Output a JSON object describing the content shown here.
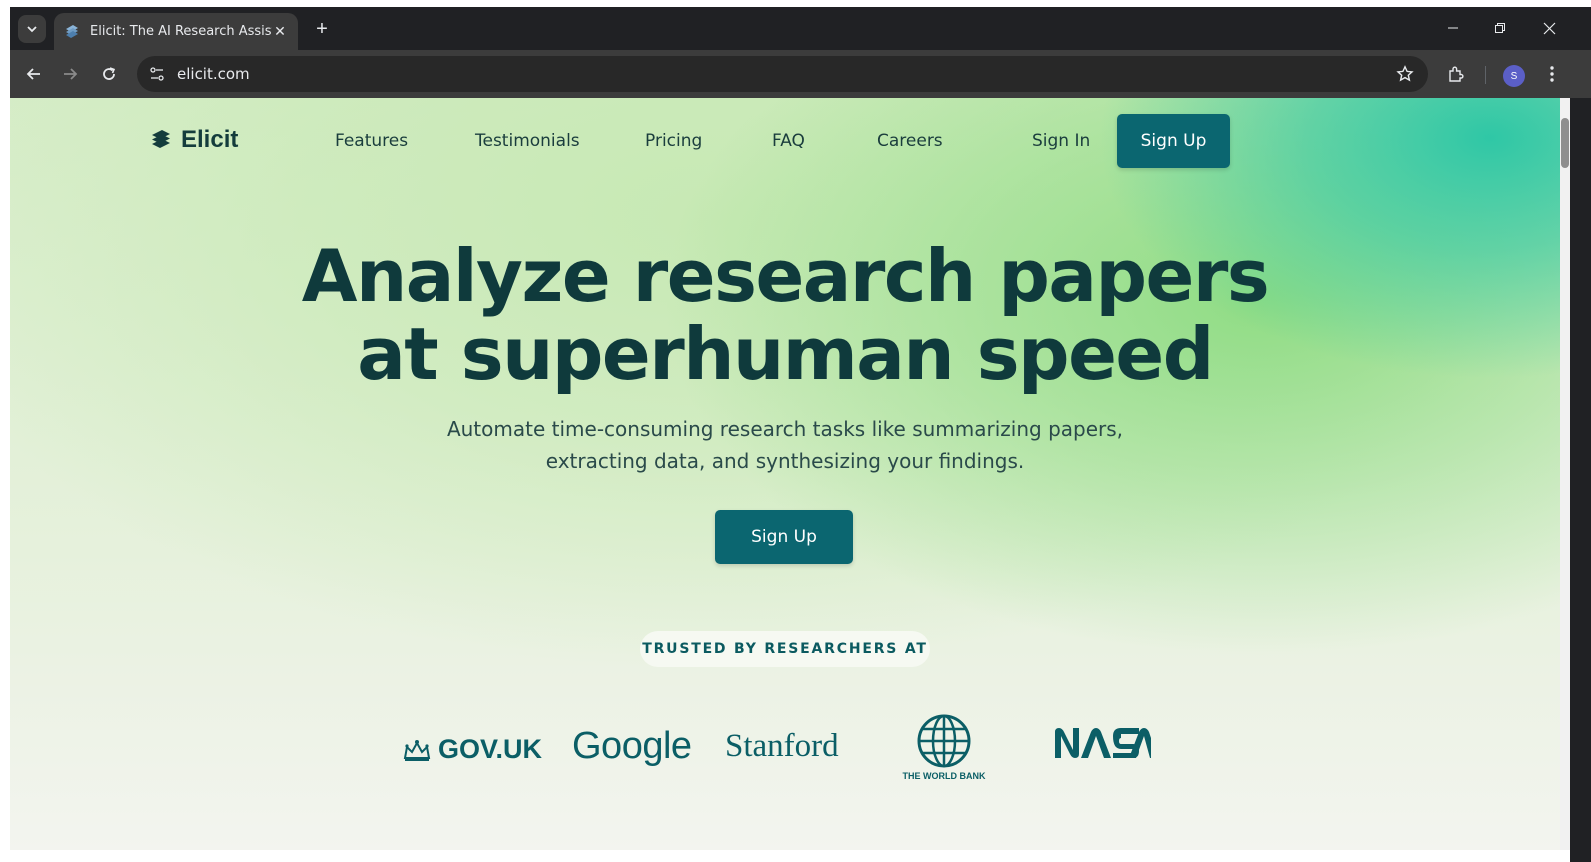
{
  "browser": {
    "tab_title": "Elicit: The AI Research Assistant",
    "url": "elicit.com",
    "profile_initial": "S"
  },
  "site": {
    "logo_text": "Elicit",
    "nav": {
      "features": "Features",
      "testimonials": "Testimonials",
      "pricing": "Pricing",
      "faq": "FAQ",
      "careers": "Careers",
      "sign_in": "Sign In",
      "sign_up": "Sign Up"
    },
    "hero": {
      "headline_line1": "Analyze research papers",
      "headline_line2": "at superhuman speed",
      "sub_line1": "Automate time-consuming research tasks like summarizing papers,",
      "sub_line2": "extracting data, and synthesizing your findings.",
      "cta": "Sign Up"
    },
    "trusted": {
      "label": "TRUSTED BY RESEARCHERS AT",
      "logos": {
        "gov_uk": "GOV.UK",
        "google": "Google",
        "stanford": "Stanford",
        "world_bank": "THE WORLD BANK",
        "nasa": "NASA"
      }
    }
  },
  "colors": {
    "brand_teal": "#0b6670",
    "heading": "#0f3a3c"
  }
}
